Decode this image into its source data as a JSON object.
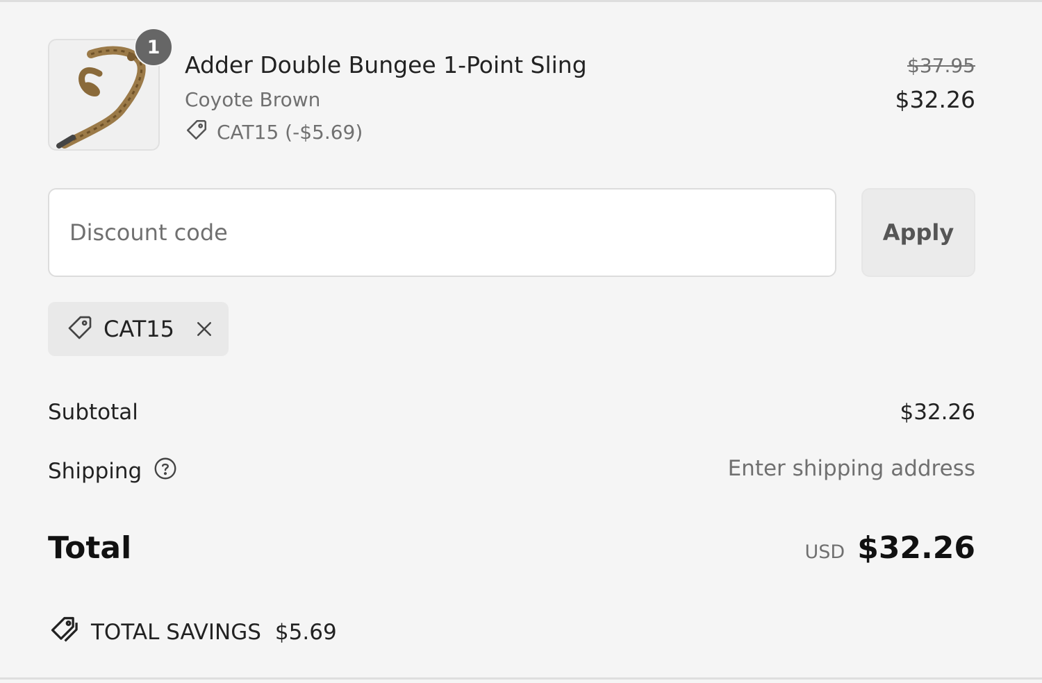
{
  "cart": {
    "item": {
      "quantity": "1",
      "name": "Adder Double Bungee 1-Point Sling",
      "variant": "Coyote Brown",
      "discount_line": "CAT15 (-$5.69)",
      "original_price": "$37.95",
      "price": "$32.26",
      "image_icon": "sling-product-image"
    }
  },
  "discount": {
    "placeholder": "Discount code",
    "value": "",
    "apply_label": "Apply",
    "applied_code": "CAT15"
  },
  "summary": {
    "subtotal_label": "Subtotal",
    "subtotal_value": "$32.26",
    "shipping_label": "Shipping",
    "shipping_value": "Enter shipping address",
    "total_label": "Total",
    "currency": "USD",
    "total_value": "$32.26",
    "savings_label": "TOTAL SAVINGS",
    "savings_value": "$5.69"
  },
  "colors": {
    "background": "#f5f5f5",
    "muted_text": "#707070",
    "badge": "#666666"
  }
}
